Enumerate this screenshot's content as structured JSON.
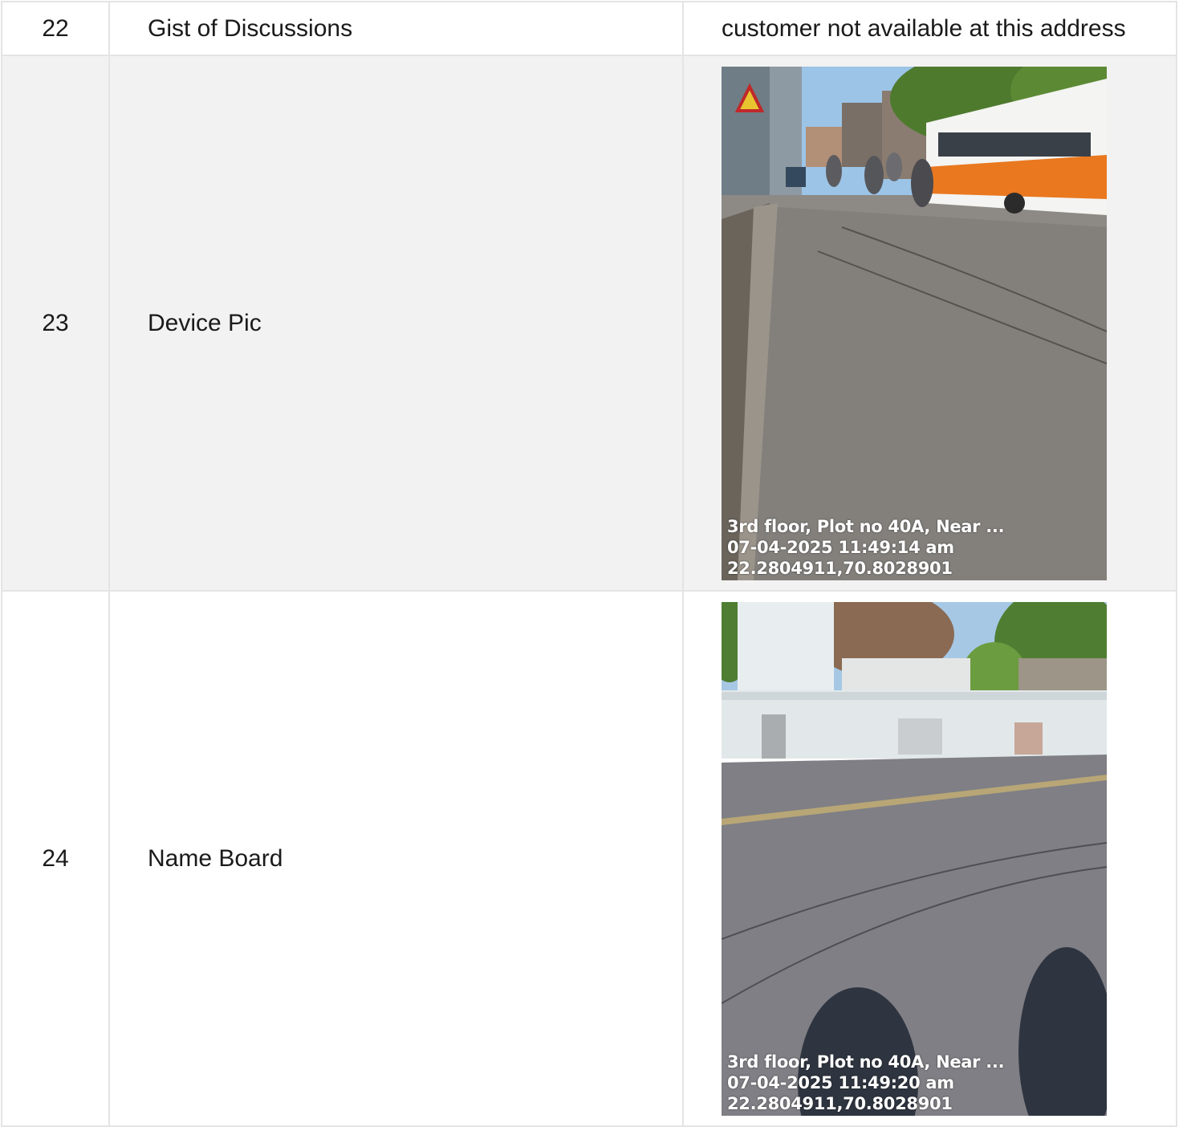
{
  "rows": [
    {
      "num": "22",
      "label": "Gist of Discussions",
      "value": "customer not available at this address"
    },
    {
      "num": "23",
      "label": "Device Pic",
      "photo": {
        "scene": "street-with-bus-and-motorbikes",
        "stamp_address": "3rd floor, Plot no 40A, Near ...",
        "stamp_datetime": "07-04-2025 11:49:14 am",
        "stamp_coords": "22.2804911,70.8028901"
      }
    },
    {
      "num": "24",
      "label": "Name Board",
      "photo": {
        "scene": "street-with-white-compound-walls",
        "stamp_address": "3rd floor, Plot no 40A, Near ...",
        "stamp_datetime": "07-04-2025 11:49:20 am",
        "stamp_coords": "22.2804911,70.8028901"
      }
    }
  ],
  "colors": {
    "border": "#e4e4e4",
    "shaded_row": "#f2f2f2",
    "text": "#1a1a1a",
    "stamp_text": "#ffffff"
  }
}
